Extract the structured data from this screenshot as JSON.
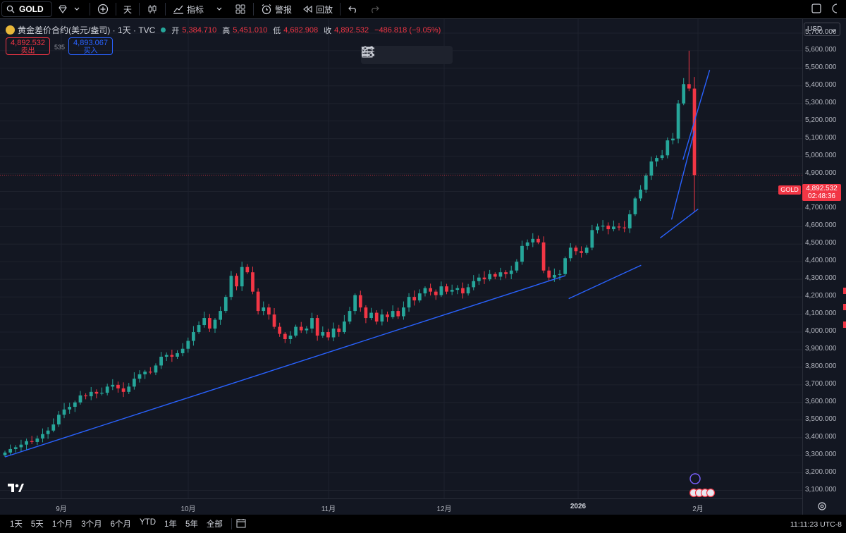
{
  "toolbar": {
    "symbol": "GOLD",
    "interval": "天",
    "indicators_label": "指标",
    "alert_label": "警报",
    "replay_label": "回放"
  },
  "legend": {
    "title": "黄金差价合约(美元/盎司) · 1天 · TVC",
    "open_label": "开",
    "open": "5,384.710",
    "high_label": "高",
    "high": "5,451.010",
    "low_label": "低",
    "low": "4,682.908",
    "close_label": "收",
    "close": "4,892.532",
    "change": "−486.818 (−9.05%)"
  },
  "trade": {
    "sell_price": "4,892.532",
    "sell_label": "卖出",
    "buy_price": "4,893.067",
    "buy_label": "买入",
    "spread": "535"
  },
  "price_scale": {
    "currency": "USD",
    "last_price": "4,892.532",
    "countdown": "02:48:36",
    "symbol_tag": "GOLD"
  },
  "time_axis": [
    "9月",
    "10月",
    "11月",
    "12月",
    "2026",
    "2月"
  ],
  "bottom_bar": {
    "ranges": [
      "1天",
      "5天",
      "1个月",
      "3个月",
      "6个月",
      "YTD",
      "1年",
      "5年",
      "全部"
    ],
    "clock": "11:11:23 UTC-8"
  },
  "colors": {
    "up": "#26a69a",
    "down": "#f23645",
    "trendline": "#2962ff",
    "background": "#131722"
  },
  "chart_data": {
    "type": "candlestick",
    "symbol": "GOLD",
    "interval": "1D",
    "ylim": [
      3050,
      5780
    ],
    "y_ticks": [
      "3,100.000",
      "3,200.000",
      "3,300.000",
      "3,400.000",
      "3,500.000",
      "3,600.000",
      "3,700.000",
      "3,800.000",
      "3,900.000",
      "4,000.000",
      "4,100.000",
      "4,200.000",
      "4,300.000",
      "4,400.000",
      "4,500.000",
      "4,600.000",
      "4,700.000",
      "4,800.000",
      "4,900.000",
      "5,000.000",
      "5,100.000",
      "5,200.000",
      "5,300.000",
      "5,400.000",
      "5,500.000",
      "5,600.000",
      "5,700.000"
    ],
    "closes": [
      3315,
      3335,
      3345,
      3360,
      3380,
      3375,
      3395,
      3420,
      3440,
      3475,
      3530,
      3560,
      3575,
      3600,
      3640,
      3635,
      3660,
      3650,
      3655,
      3690,
      3700,
      3680,
      3660,
      3690,
      3735,
      3760,
      3775,
      3770,
      3810,
      3860,
      3870,
      3860,
      3880,
      3905,
      3950,
      4000,
      4040,
      4080,
      4020,
      4070,
      4120,
      4200,
      4320,
      4260,
      4370,
      4340,
      4230,
      4120,
      4140,
      4100,
      4030,
      3990,
      3960,
      3980,
      4030,
      4010,
      4020,
      4080,
      3980,
      4000,
      3970,
      4020,
      4000,
      4060,
      4120,
      4210,
      4140,
      4080,
      4110,
      4060,
      4100,
      4085,
      4120,
      4090,
      4140,
      4200,
      4180,
      4220,
      4250,
      4230,
      4210,
      4260,
      4230,
      4240,
      4250,
      4220,
      4255,
      4290,
      4310,
      4300,
      4330,
      4315,
      4340,
      4330,
      4350,
      4400,
      4490,
      4510,
      4530,
      4510,
      4350,
      4310,
      4325,
      4330,
      4420,
      4480,
      4460,
      4450,
      4480,
      4580,
      4600,
      4605,
      4585,
      4600,
      4595,
      4590,
      4670,
      4760,
      4810,
      4890,
      4970,
      4990,
      5005,
      5090,
      5100,
      5300,
      5410,
      5385,
      4892.532
    ],
    "trendlines": [
      {
        "from": [
          "2025-08-01",
          3290
        ],
        "to": [
          "2025-12-26",
          4320
        ]
      },
      {
        "from": [
          "2025-12-27",
          4190
        ],
        "to": [
          "2026-01-15",
          4380
        ]
      },
      {
        "from": [
          "2026-01-20",
          4535
        ],
        "to": [
          "2026-01-30",
          4700
        ]
      },
      {
        "from": [
          "2026-01-23",
          4640
        ],
        "to": [
          "2026-01-29",
          5145
        ]
      },
      {
        "from": [
          "2026-01-26",
          4980
        ],
        "to": [
          "2026-02-02",
          5490
        ]
      }
    ]
  }
}
